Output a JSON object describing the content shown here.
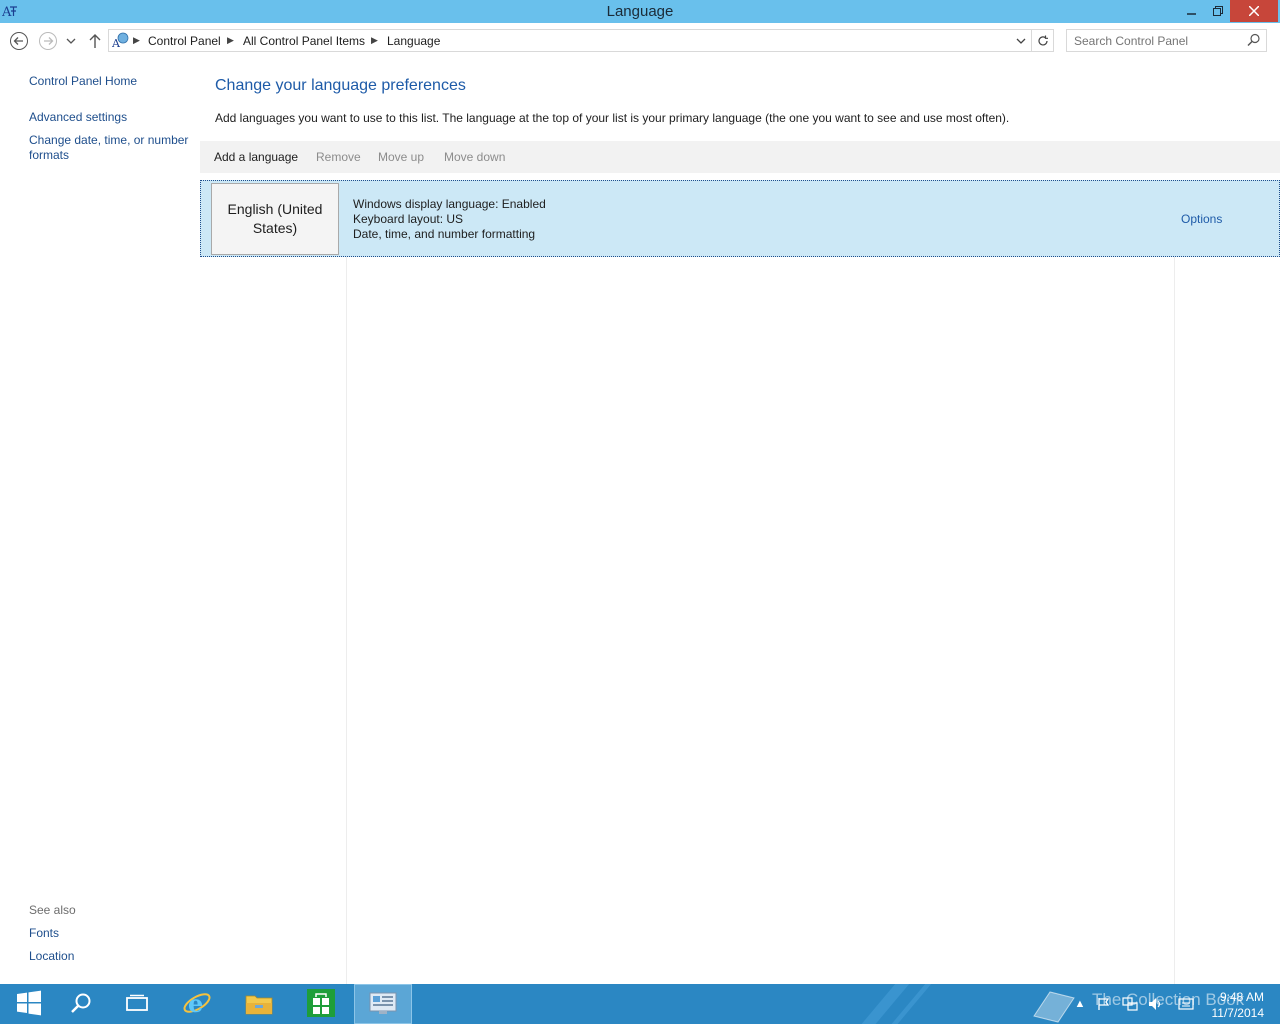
{
  "window": {
    "title": "Language"
  },
  "address": {
    "breadcrumbs": [
      "Control Panel",
      "All Control Panel Items",
      "Language"
    ]
  },
  "search": {
    "placeholder": "Search Control Panel"
  },
  "left_pane": {
    "home": "Control Panel Home",
    "links": [
      "Advanced settings",
      "Change date, time, or number formats"
    ],
    "see_also_label": "See also",
    "see_also": [
      "Fonts",
      "Location"
    ]
  },
  "content": {
    "heading": "Change your language preferences",
    "description": "Add languages you want to use to this list. The language at the top of your list is your primary language (the one you want to see and use most often).",
    "toolbar": {
      "add": "Add a language",
      "remove": "Remove",
      "move_up": "Move up",
      "move_down": "Move down"
    },
    "languages": [
      {
        "name": "English (United States)",
        "details": [
          "Windows display language: Enabled",
          "Keyboard layout: US",
          "Date, time, and number formatting"
        ],
        "options": "Options"
      }
    ]
  },
  "taskbar": {
    "apps": [
      "start-icon",
      "search-icon",
      "task-view-icon",
      "internet-explorer-icon",
      "file-explorer-icon",
      "store-icon",
      "control-panel-icon"
    ],
    "watermark": "The Collection Book",
    "clock_time": "9:48 AM",
    "clock_date": "11/7/2014"
  },
  "colors": {
    "titlebar": "#69c0ec",
    "link": "#1e4e8c",
    "heading": "#1e5ba8",
    "selection": "#cce8f6",
    "taskbar": "#2b87c3",
    "close_button": "#c7463a"
  }
}
